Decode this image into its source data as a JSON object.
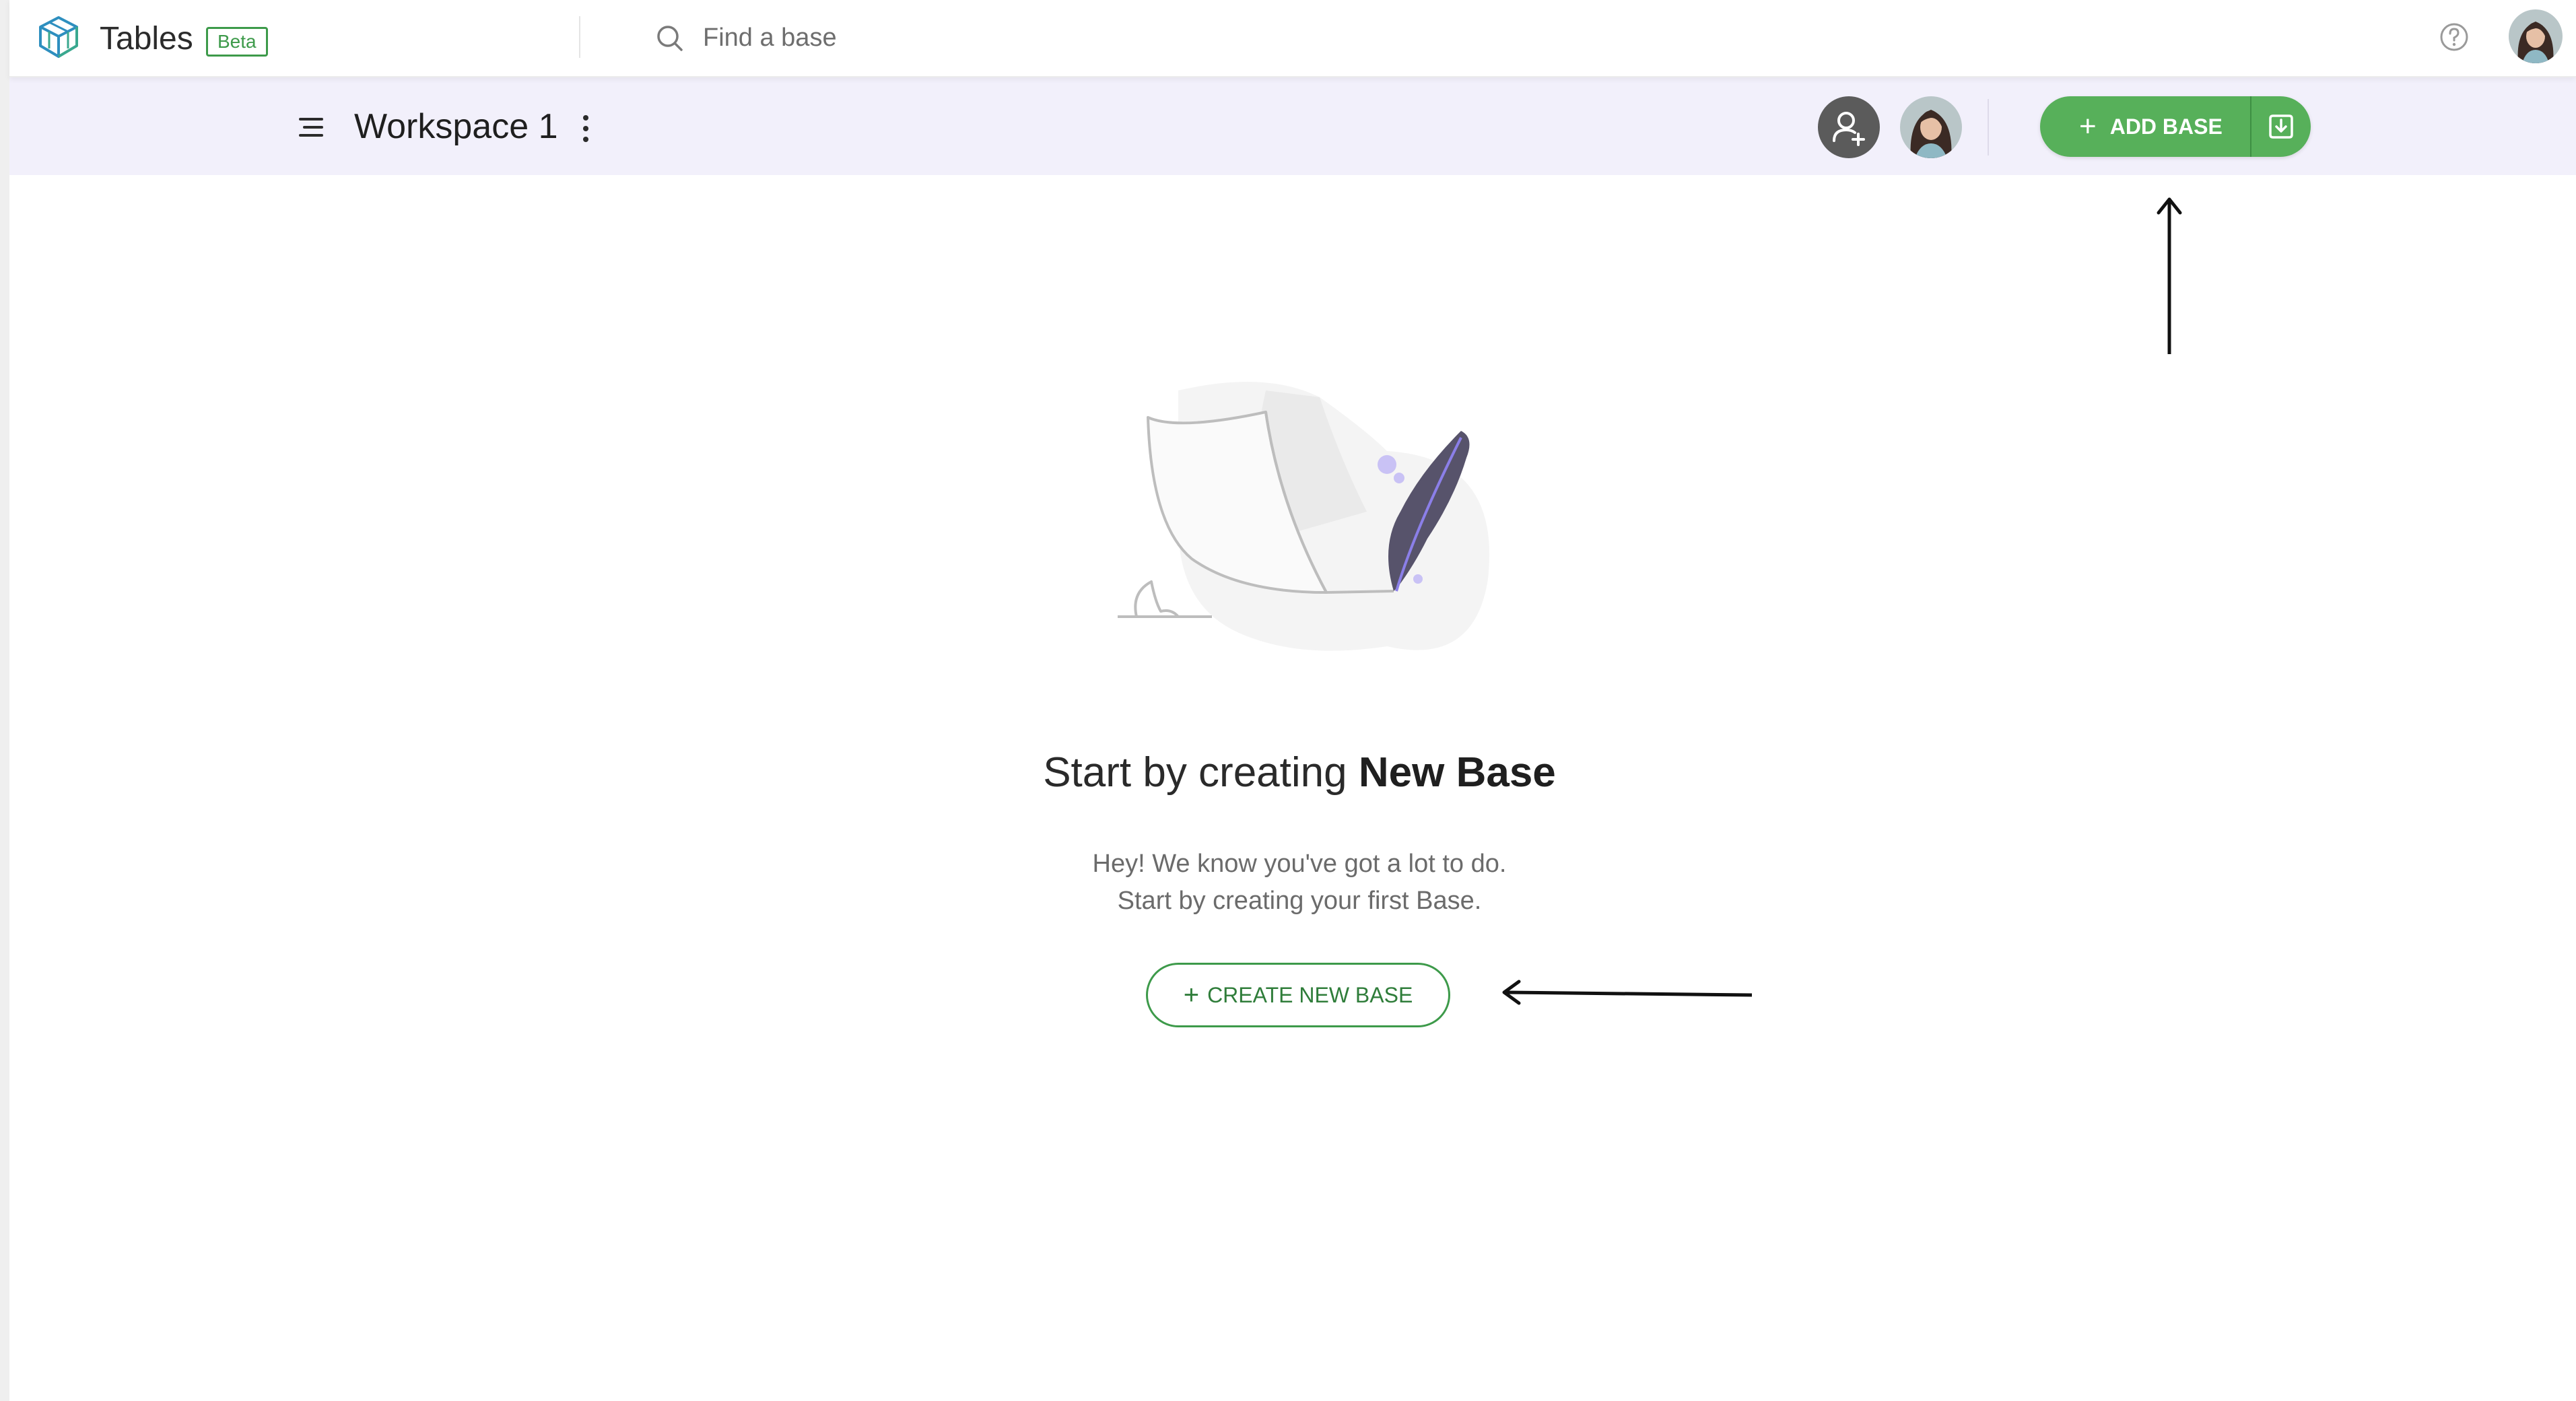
{
  "app": {
    "title": "Tables",
    "badge": "Beta",
    "logo_icon": "cube-logo-icon",
    "accent_color": "#57b05a",
    "brand_color": "#2e8fbf"
  },
  "search": {
    "placeholder": "Find a base",
    "value": "",
    "icon": "search-icon"
  },
  "header": {
    "help_icon": "help-circle-icon",
    "avatar": "user-avatar"
  },
  "workspace": {
    "title": "Workspace 1",
    "menu_icon": "hamburger-icon",
    "more_icon": "kebab-menu-icon",
    "invite_icon": "add-user-icon",
    "add_base_label": "ADD BASE",
    "add_base_plus": "+",
    "import_icon": "download-icon"
  },
  "empty_state": {
    "title_prefix": "Start by creating",
    "title_bold": "New Base",
    "description_line1": "Hey! We know you've got a lot to do.",
    "description_line2": "Start by creating your first Base.",
    "button_plus": "+",
    "button_label": "CREATE NEW BASE",
    "illustration": "paper-and-quill-illustration"
  },
  "annotations": {
    "arrow_up_icon": "arrow-up-icon",
    "arrow_left_icon": "arrow-left-icon"
  }
}
